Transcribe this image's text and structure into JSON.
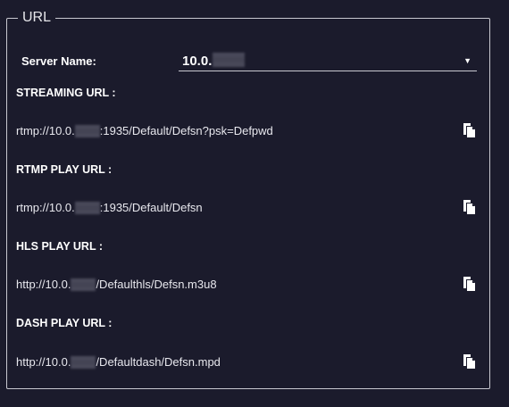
{
  "fieldset": {
    "legend": "URL"
  },
  "server": {
    "label": "Server Name:",
    "value_prefix": "10.0."
  },
  "urls": [
    {
      "label": "STREAMING URL :",
      "prefix": "rtmp://10.0.",
      "suffix": ":1935/Default/Defsn?psk=Defpwd"
    },
    {
      "label": "RTMP PLAY URL :",
      "prefix": "rtmp://10.0.",
      "suffix": ":1935/Default/Defsn"
    },
    {
      "label": "HLS PLAY URL :",
      "prefix": "http://10.0.",
      "suffix": "/Defaulthls/Defsn.m3u8"
    },
    {
      "label": "DASH PLAY URL :",
      "prefix": "http://10.0.",
      "suffix": "/Defaultdash/Defsn.mpd"
    }
  ],
  "icons": {
    "dropdown": "caret-down-icon",
    "copy": "copy-icon"
  },
  "colors": {
    "background": "#1b1b2c",
    "border": "#c8c8d0",
    "text": "#ffffff"
  }
}
